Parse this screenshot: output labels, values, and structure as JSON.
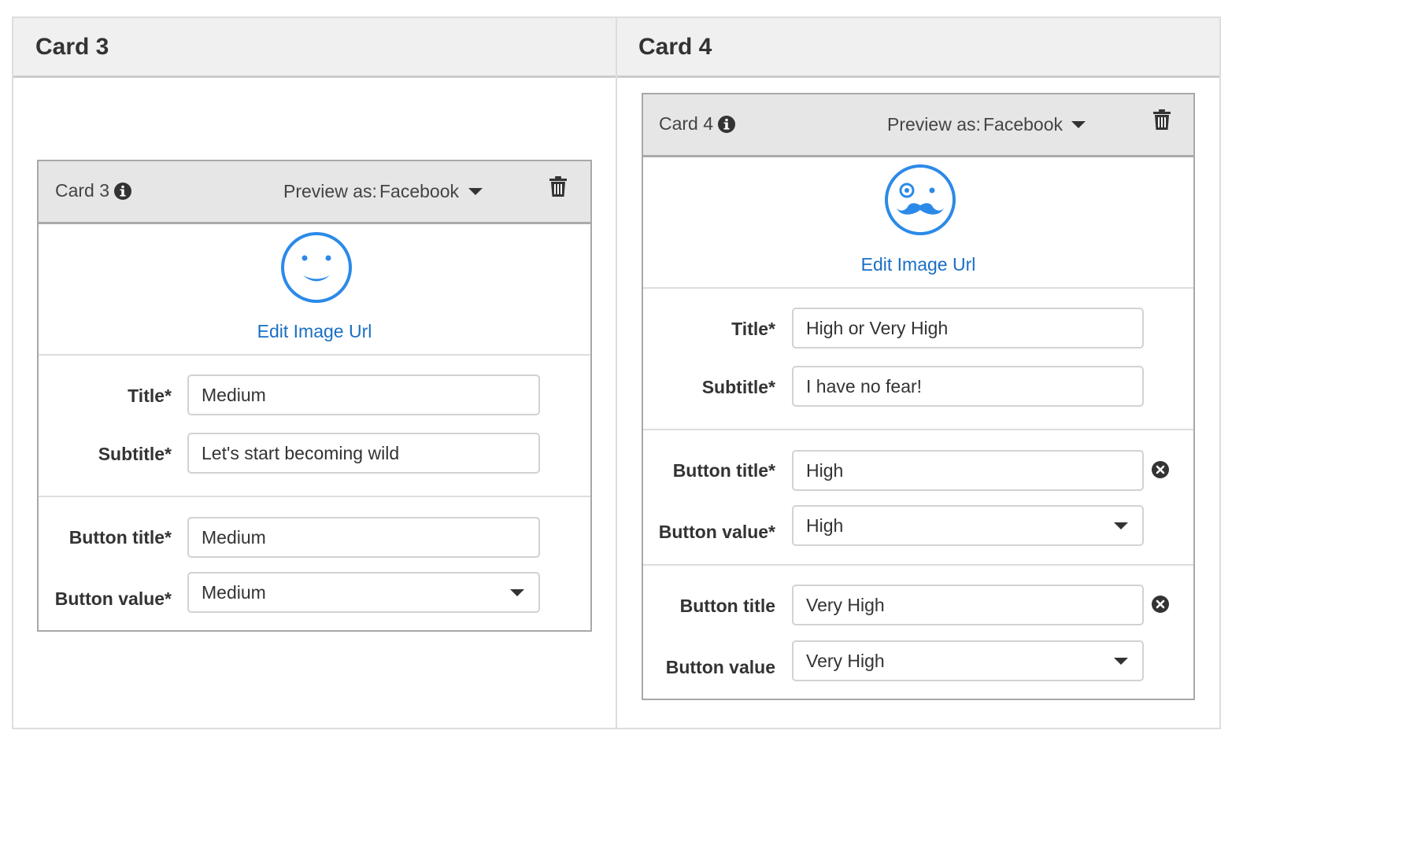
{
  "panels": [
    {
      "title": "Card 3",
      "card": {
        "name": "Card 3",
        "preview_label": "Preview as:",
        "preview_value": "Facebook",
        "image_icon": "smiley-face-icon",
        "edit_image_link": "Edit Image Url",
        "fields": {
          "title_label": "Title*",
          "title_value": "Medium",
          "subtitle_label": "Subtitle*",
          "subtitle_value": "Let's start becoming wild"
        },
        "buttons": [
          {
            "title_label": "Button title*",
            "title_value": "Medium",
            "value_label": "Button value*",
            "value_selected": "Medium"
          }
        ]
      }
    },
    {
      "title": "Card 4",
      "card": {
        "name": "Card 4",
        "preview_label": "Preview as:",
        "preview_value": "Facebook",
        "image_icon": "mustache-face-icon",
        "edit_image_link": "Edit Image Url",
        "fields": {
          "title_label": "Title*",
          "title_value": "High or Very High",
          "subtitle_label": "Subtitle*",
          "subtitle_value": "I have no fear!"
        },
        "buttons": [
          {
            "title_label": "Button title*",
            "title_value": "High",
            "value_label": "Button value*",
            "value_selected": "High"
          },
          {
            "title_label": "Button title",
            "title_value": "Very High",
            "value_label": "Button value",
            "value_selected": "Very High"
          }
        ]
      }
    }
  ],
  "colors": {
    "accent": "#2b8ae8",
    "link": "#1a6fc4",
    "header_bg": "#e6e6e6",
    "outer_header_bg": "#f0f0f0"
  }
}
